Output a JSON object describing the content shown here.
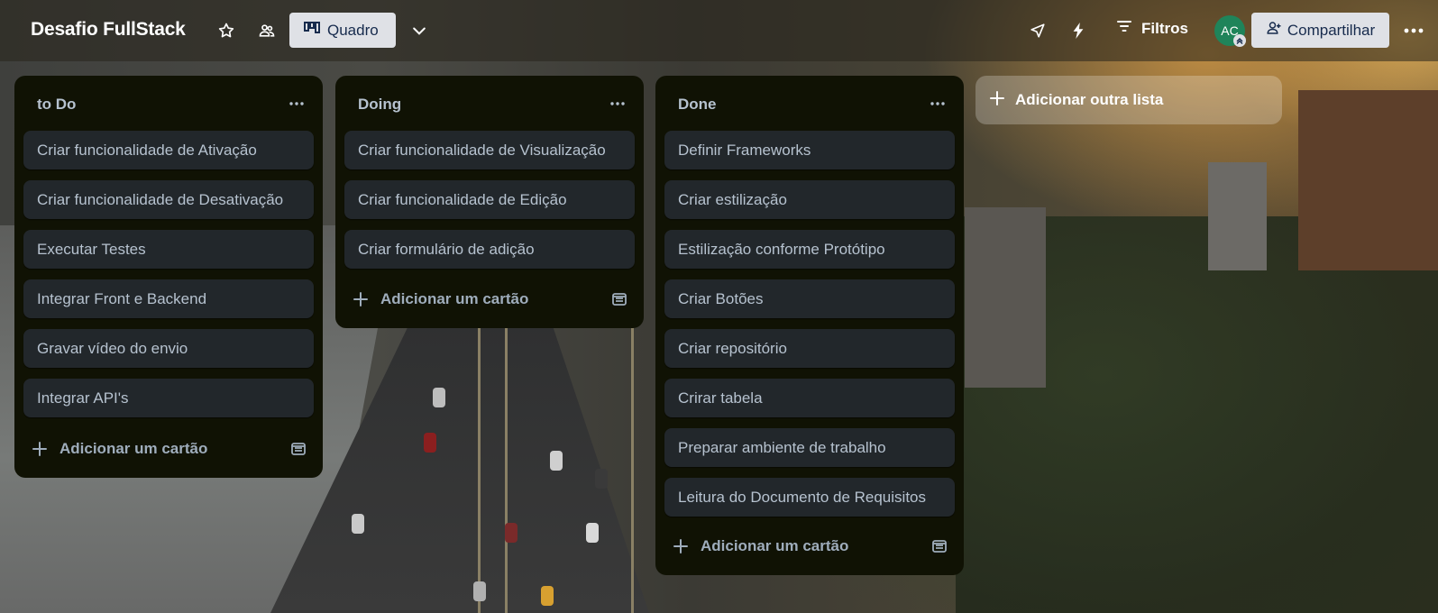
{
  "header": {
    "board_title": "Desafio FullStack",
    "view_label": "Quadro",
    "filters_label": "Filtros",
    "avatar_initials": "AC",
    "share_label": "Compartilhar"
  },
  "lists": [
    {
      "title": "to Do",
      "cards": [
        "Criar funcionalidade de Ativação",
        "Criar funcionalidade de Desativação",
        "Executar Testes",
        "Integrar Front e Backend",
        "Gravar vídeo do envio",
        "Integrar API's"
      ],
      "add_card_label": "Adicionar um cartão"
    },
    {
      "title": "Doing",
      "cards": [
        "Criar funcionalidade de Visualização",
        "Criar funcionalidade de Edição",
        "Criar formulário de adição"
      ],
      "add_card_label": "Adicionar um cartão"
    },
    {
      "title": "Done",
      "cards": [
        "Definir Frameworks",
        "Criar estilização",
        "Estilização conforme Protótipo",
        "Criar Botões",
        "Criar repositório",
        "Crirar tabela",
        "Preparar ambiente de trabalho",
        "Leitura do Documento de Requisitos"
      ],
      "add_card_label": "Adicionar um cartão"
    }
  ],
  "add_list_label": "Adicionar outra lista",
  "colors": {
    "list_bg": "#101204",
    "card_bg": "#22272b",
    "card_text": "#b6c2cf",
    "avatar_bg": "#1f845a",
    "button_bg": "#dfe1e6"
  },
  "icons": [
    "star-icon",
    "workspace-visibility-icon",
    "board-view-icon",
    "chevron-down-icon",
    "power-ups-icon",
    "automation-icon",
    "filter-icon",
    "add-member-icon",
    "more-icon",
    "plus-icon",
    "template-icon"
  ]
}
